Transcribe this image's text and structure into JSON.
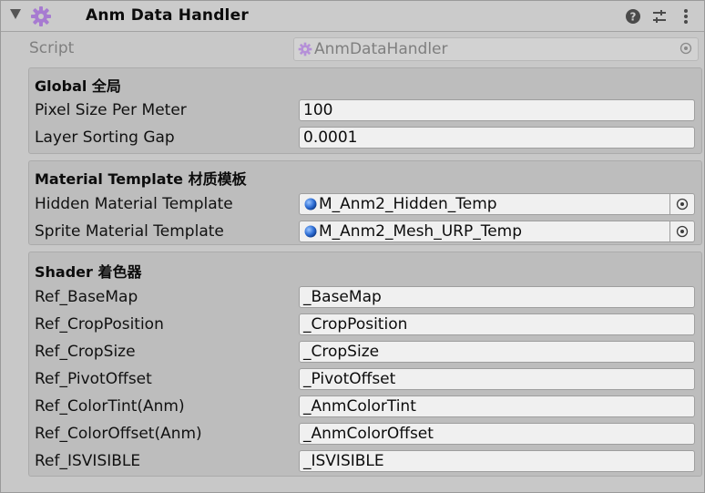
{
  "header": {
    "title": "Anm Data Handler"
  },
  "script": {
    "label": "Script",
    "value": "AnmDataHandler"
  },
  "global": {
    "title": "Global 全局",
    "fields": [
      {
        "label": "Pixel Size Per Meter",
        "value": "100"
      },
      {
        "label": "Layer Sorting Gap",
        "value": "0.0001"
      }
    ]
  },
  "material": {
    "title": "Material Template 材质模板",
    "fields": [
      {
        "label": "Hidden Material Template",
        "value": "M_Anm2_Hidden_Temp"
      },
      {
        "label": "Sprite Material Template",
        "value": "M_Anm2_Mesh_URP_Temp"
      }
    ]
  },
  "shader": {
    "title": "Shader 着色器",
    "fields": [
      {
        "label": "Ref_BaseMap",
        "value": "_BaseMap"
      },
      {
        "label": "Ref_CropPosition",
        "value": "_CropPosition"
      },
      {
        "label": "Ref_CropSize",
        "value": "_CropSize"
      },
      {
        "label": "Ref_PivotOffset",
        "value": "_PivotOffset"
      },
      {
        "label": "Ref_ColorTint(Anm)",
        "value": "_AnmColorTint"
      },
      {
        "label": "Ref_ColorOffset(Anm)",
        "value": "_AnmColorOffset"
      },
      {
        "label": "Ref_ISVISIBLE",
        "value": "_ISVISIBLE"
      }
    ]
  },
  "colors": {
    "background": "#c8c8c8",
    "field": "#f0f0f0",
    "group": "#bdbdbd",
    "script_icon": "#a77bd1",
    "material_icon": "#2f6fd6"
  },
  "icons": {
    "component": "gear-icon",
    "help": "help-icon",
    "presets": "presets-icon",
    "menu": "kebab-menu-icon",
    "material": "material-sphere-icon",
    "picker": "object-picker-icon"
  }
}
